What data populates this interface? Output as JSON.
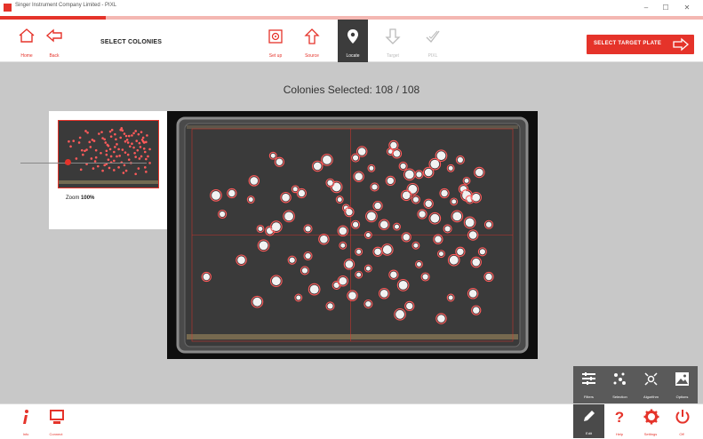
{
  "window": {
    "title": "Singer Instrument Company Limited - PIXL",
    "min_symbol": "–",
    "max_symbol": "☐",
    "close_symbol": "✕"
  },
  "progress": {
    "fraction": 0.15,
    "color": "#e5332a"
  },
  "toolbar": {
    "home_label": "Home",
    "back_label": "Back",
    "page_title": "SELECT COLONIES",
    "steps": [
      {
        "label": "Set up",
        "icon": "setup-icon",
        "state": "done"
      },
      {
        "label": "Source",
        "icon": "source-icon",
        "state": "done"
      },
      {
        "label": "Locate",
        "icon": "locate-icon",
        "state": "active"
      },
      {
        "label": "Target",
        "icon": "target-icon",
        "state": "disabled"
      },
      {
        "label": "PIXL",
        "icon": "pixl-icon",
        "state": "disabled"
      }
    ],
    "target_button_label": "SELECT TARGET PLATE"
  },
  "main": {
    "colonies_selected": "Colonies Selected: 108 / 108",
    "zoom_label": "Zoom",
    "zoom_value": "100%",
    "zoom_fraction": 0.38
  },
  "plate": {
    "colony_color": "#ff5a5a",
    "grid_color": "#e5332a",
    "colonies": [
      [
        0.25,
        0.12
      ],
      [
        0.27,
        0.15
      ],
      [
        0.42,
        0.14
      ],
      [
        0.51,
        0.13
      ],
      [
        0.53,
        0.1
      ],
      [
        0.62,
        0.1
      ],
      [
        0.64,
        0.11
      ],
      [
        0.78,
        0.12
      ],
      [
        0.66,
        0.17
      ],
      [
        0.19,
        0.24
      ],
      [
        0.32,
        0.28
      ],
      [
        0.34,
        0.3
      ],
      [
        0.45,
        0.27
      ],
      [
        0.43,
        0.25
      ],
      [
        0.52,
        0.22
      ],
      [
        0.18,
        0.33
      ],
      [
        0.12,
        0.3
      ],
      [
        0.07,
        0.31
      ],
      [
        0.71,
        0.21
      ],
      [
        0.74,
        0.2
      ],
      [
        0.81,
        0.18
      ],
      [
        0.79,
        0.3
      ],
      [
        0.69,
        0.28
      ],
      [
        0.7,
        0.33
      ],
      [
        0.67,
        0.31
      ],
      [
        0.82,
        0.34
      ],
      [
        0.85,
        0.28
      ],
      [
        0.86,
        0.31
      ],
      [
        0.87,
        0.33
      ],
      [
        0.89,
        0.32
      ],
      [
        0.48,
        0.37
      ],
      [
        0.49,
        0.39
      ],
      [
        0.56,
        0.41
      ],
      [
        0.51,
        0.45
      ],
      [
        0.6,
        0.45
      ],
      [
        0.21,
        0.47
      ],
      [
        0.24,
        0.48
      ],
      [
        0.26,
        0.46
      ],
      [
        0.36,
        0.47
      ],
      [
        0.47,
        0.48
      ],
      [
        0.64,
        0.46
      ],
      [
        0.72,
        0.4
      ],
      [
        0.76,
        0.42
      ],
      [
        0.8,
        0.47
      ],
      [
        0.88,
        0.5
      ],
      [
        0.47,
        0.55
      ],
      [
        0.58,
        0.58
      ],
      [
        0.61,
        0.57
      ],
      [
        0.36,
        0.6
      ],
      [
        0.49,
        0.64
      ],
      [
        0.55,
        0.66
      ],
      [
        0.84,
        0.58
      ],
      [
        0.82,
        0.62
      ],
      [
        0.91,
        0.58
      ],
      [
        0.89,
        0.63
      ],
      [
        0.78,
        0.59
      ],
      [
        0.04,
        0.7
      ],
      [
        0.38,
        0.76
      ],
      [
        0.45,
        0.74
      ],
      [
        0.47,
        0.72
      ],
      [
        0.52,
        0.69
      ],
      [
        0.63,
        0.69
      ],
      [
        0.66,
        0.74
      ],
      [
        0.73,
        0.7
      ],
      [
        0.88,
        0.78
      ],
      [
        0.33,
        0.8
      ],
      [
        0.68,
        0.84
      ],
      [
        0.65,
        0.88
      ],
      [
        0.55,
        0.83
      ],
      [
        0.78,
        0.9
      ],
      [
        0.56,
        0.18
      ],
      [
        0.63,
        0.07
      ],
      [
        0.68,
        0.21
      ],
      [
        0.57,
        0.27
      ],
      [
        0.29,
        0.32
      ],
      [
        0.86,
        0.24
      ],
      [
        0.74,
        0.35
      ],
      [
        0.22,
        0.55
      ],
      [
        0.31,
        0.62
      ],
      [
        0.41,
        0.52
      ],
      [
        0.52,
        0.58
      ],
      [
        0.58,
        0.36
      ],
      [
        0.83,
        0.41
      ],
      [
        0.93,
        0.45
      ],
      [
        0.15,
        0.62
      ],
      [
        0.7,
        0.55
      ],
      [
        0.77,
        0.52
      ],
      [
        0.87,
        0.44
      ],
      [
        0.43,
        0.84
      ],
      [
        0.6,
        0.78
      ],
      [
        0.71,
        0.64
      ],
      [
        0.93,
        0.7
      ],
      [
        0.26,
        0.72
      ],
      [
        0.35,
        0.67
      ],
      [
        0.5,
        0.79
      ],
      [
        0.81,
        0.8
      ],
      [
        0.89,
        0.86
      ],
      [
        0.2,
        0.82
      ],
      [
        0.09,
        0.4
      ],
      [
        0.39,
        0.17
      ],
      [
        0.46,
        0.33
      ],
      [
        0.62,
        0.24
      ],
      [
        0.76,
        0.16
      ],
      [
        0.84,
        0.14
      ],
      [
        0.9,
        0.2
      ],
      [
        0.55,
        0.5
      ],
      [
        0.67,
        0.51
      ],
      [
        0.3,
        0.41
      ]
    ]
  },
  "bottom": {
    "info_label": "Info",
    "connect_label": "Connect",
    "help_label": "Help",
    "settings_label": "Settings",
    "off_label": "Off",
    "edit_label": "Edit"
  },
  "tools": [
    {
      "label": "Filters",
      "icon": "filters-icon"
    },
    {
      "label": "Selection",
      "icon": "selection-icon"
    },
    {
      "label": "Algorithm",
      "icon": "algorithm-icon"
    },
    {
      "label": "Options",
      "icon": "options-icon"
    }
  ]
}
